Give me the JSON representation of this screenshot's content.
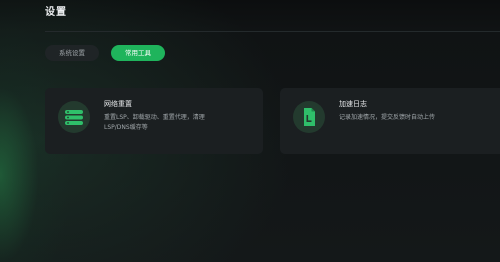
{
  "header": {
    "title": "设置"
  },
  "tabs": [
    {
      "label": "系统设置",
      "active": false
    },
    {
      "label": "常用工具",
      "active": true
    }
  ],
  "tools": [
    {
      "title": "网络重置",
      "description": "重置LSP、卸载驱动、重置代理，清理LSP/DNS缓存等",
      "icon": "network-reset-icon"
    },
    {
      "title": "加速日志",
      "description": "记录加速情况，提交反馈时自动上传",
      "icon": "log-file-icon"
    }
  ],
  "colors": {
    "accent": "#1fb45c",
    "background": "#141819",
    "card": "#1b1f21"
  }
}
